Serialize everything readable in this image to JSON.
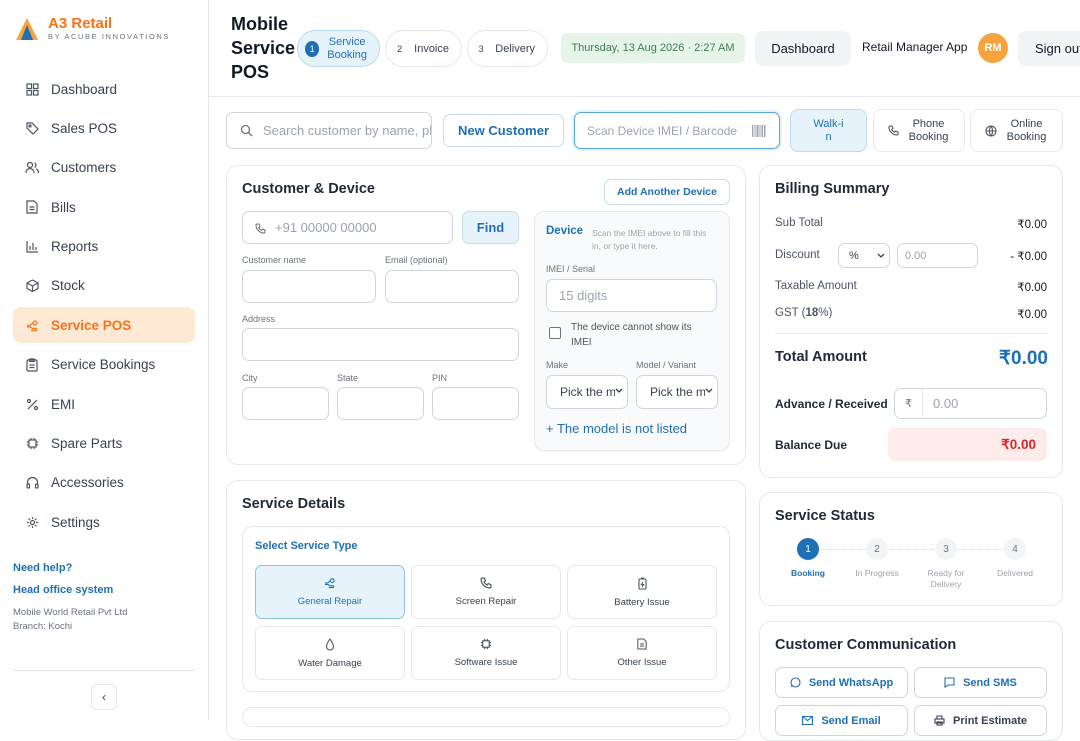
{
  "brand": {
    "name": "A3 Retail",
    "tagline": "BY ACUBE INNOVATIONS",
    "accent": "#f97316",
    "primary": "#1f6fb5"
  },
  "sidebar": {
    "items": [
      {
        "label": "Dashboard",
        "icon": "grid-icon"
      },
      {
        "label": "Sales POS",
        "icon": "tag-icon"
      },
      {
        "label": "Customers",
        "icon": "users-icon"
      },
      {
        "label": "Bills",
        "icon": "document-icon"
      },
      {
        "label": "Reports",
        "icon": "bar-chart-icon"
      },
      {
        "label": "Stock",
        "icon": "box-icon"
      },
      {
        "label": "Service POS",
        "icon": "hand-icon",
        "active": true
      },
      {
        "label": "Service Bookings",
        "icon": "clipboard-icon"
      },
      {
        "label": "EMI",
        "icon": "percent-icon"
      },
      {
        "label": "Spare Parts",
        "icon": "chip-icon"
      },
      {
        "label": "Accessories",
        "icon": "headphones-icon"
      },
      {
        "label": "Settings",
        "icon": "gear-icon"
      }
    ],
    "help": {
      "need_help": "Need help?",
      "head_office": "Head office system",
      "company": "Mobile World Retail Pvt Ltd",
      "branch": "Branch: Kochi"
    },
    "collapse_glyph": "‹"
  },
  "header": {
    "title": "Mobile Service POS",
    "steps": [
      {
        "num": "1",
        "label": "Service Booking",
        "active": true
      },
      {
        "num": "2",
        "label": "Invoice"
      },
      {
        "num": "3",
        "label": "Delivery"
      }
    ],
    "datetime": "Thursday, 13 Aug 2026 · 2:27 AM",
    "dashboard_btn": "Dashboard",
    "app_link": "Retail Manager App",
    "avatar": "RM",
    "signout": "Sign out"
  },
  "toolbar": {
    "search_placeholder": "Search customer by name, phone or IMEI",
    "new_customer": "New Customer",
    "scan_placeholder": "Scan Device IMEI / Barcode",
    "modes": [
      {
        "label": "Walk-in",
        "active": true
      },
      {
        "label": "Phone Booking",
        "icon": "phone-icon"
      },
      {
        "label": "Online Booking",
        "icon": "globe-icon"
      }
    ]
  },
  "customer": {
    "title": "Customer & Device",
    "add_device": "Add Another Device",
    "phone_placeholder": "+91 00000 00000",
    "find": "Find",
    "name_label": "Customer name",
    "email_label": "Email (optional)",
    "address_label": "Address",
    "city_label": "City",
    "state_label": "State",
    "pin_label": "PIN"
  },
  "device": {
    "title": "Device",
    "hint": "Scan the IMEI above to fill this in, or type it here.",
    "imei_label": "IMEI / Serial",
    "imei_placeholder": "15 digits",
    "no_imei": "The device cannot show its IMEI",
    "make_label": "Make",
    "model_label": "Model / Variant",
    "make_placeholder": "Pick the make",
    "model_placeholder": "Pick the model",
    "not_listed": "+ The model is not listed"
  },
  "service": {
    "title": "Service Details",
    "select_label": "Select Service Type",
    "types": [
      {
        "label": "General Repair",
        "icon": "hand-icon",
        "active": true
      },
      {
        "label": "Screen Repair",
        "icon": "phone-icon"
      },
      {
        "label": "Battery Issue",
        "icon": "battery-icon"
      },
      {
        "label": "Water Damage",
        "icon": "droplet-icon"
      },
      {
        "label": "Software Issue",
        "icon": "chip-icon"
      },
      {
        "label": "Other Issue",
        "icon": "document-icon"
      }
    ]
  },
  "billing": {
    "title": "Billing Summary",
    "subtotal_label": "Sub Total",
    "subtotal": "₹0.00",
    "discount_label": "Discount",
    "discount_type": "%",
    "discount_placeholder": "0.00",
    "discount": "- ₹0.00",
    "taxable_label": "Taxable Amount",
    "taxable": "₹0.00",
    "gst_label": "GST (",
    "gst_rate": "18",
    "gst_suffix": "%)",
    "gst": "₹0.00",
    "total_label": "Total Amount",
    "total": "₹0.00",
    "advance_label": "Advance / Received",
    "currency": "₹",
    "advance_placeholder": "0.00",
    "balance_label": "Balance Due",
    "balance": "₹0.00"
  },
  "status": {
    "title": "Service Status",
    "steps": [
      {
        "num": "1",
        "label": "Booking",
        "active": true
      },
      {
        "num": "2",
        "label": "In Progress"
      },
      {
        "num": "3",
        "label": "Ready for Delivery"
      },
      {
        "num": "4",
        "label": "Delivered"
      }
    ]
  },
  "communication": {
    "title": "Customer Communication",
    "whatsapp": "Send WhatsApp",
    "sms": "Send SMS",
    "email": "Send Email",
    "print": "Print Estimate"
  }
}
